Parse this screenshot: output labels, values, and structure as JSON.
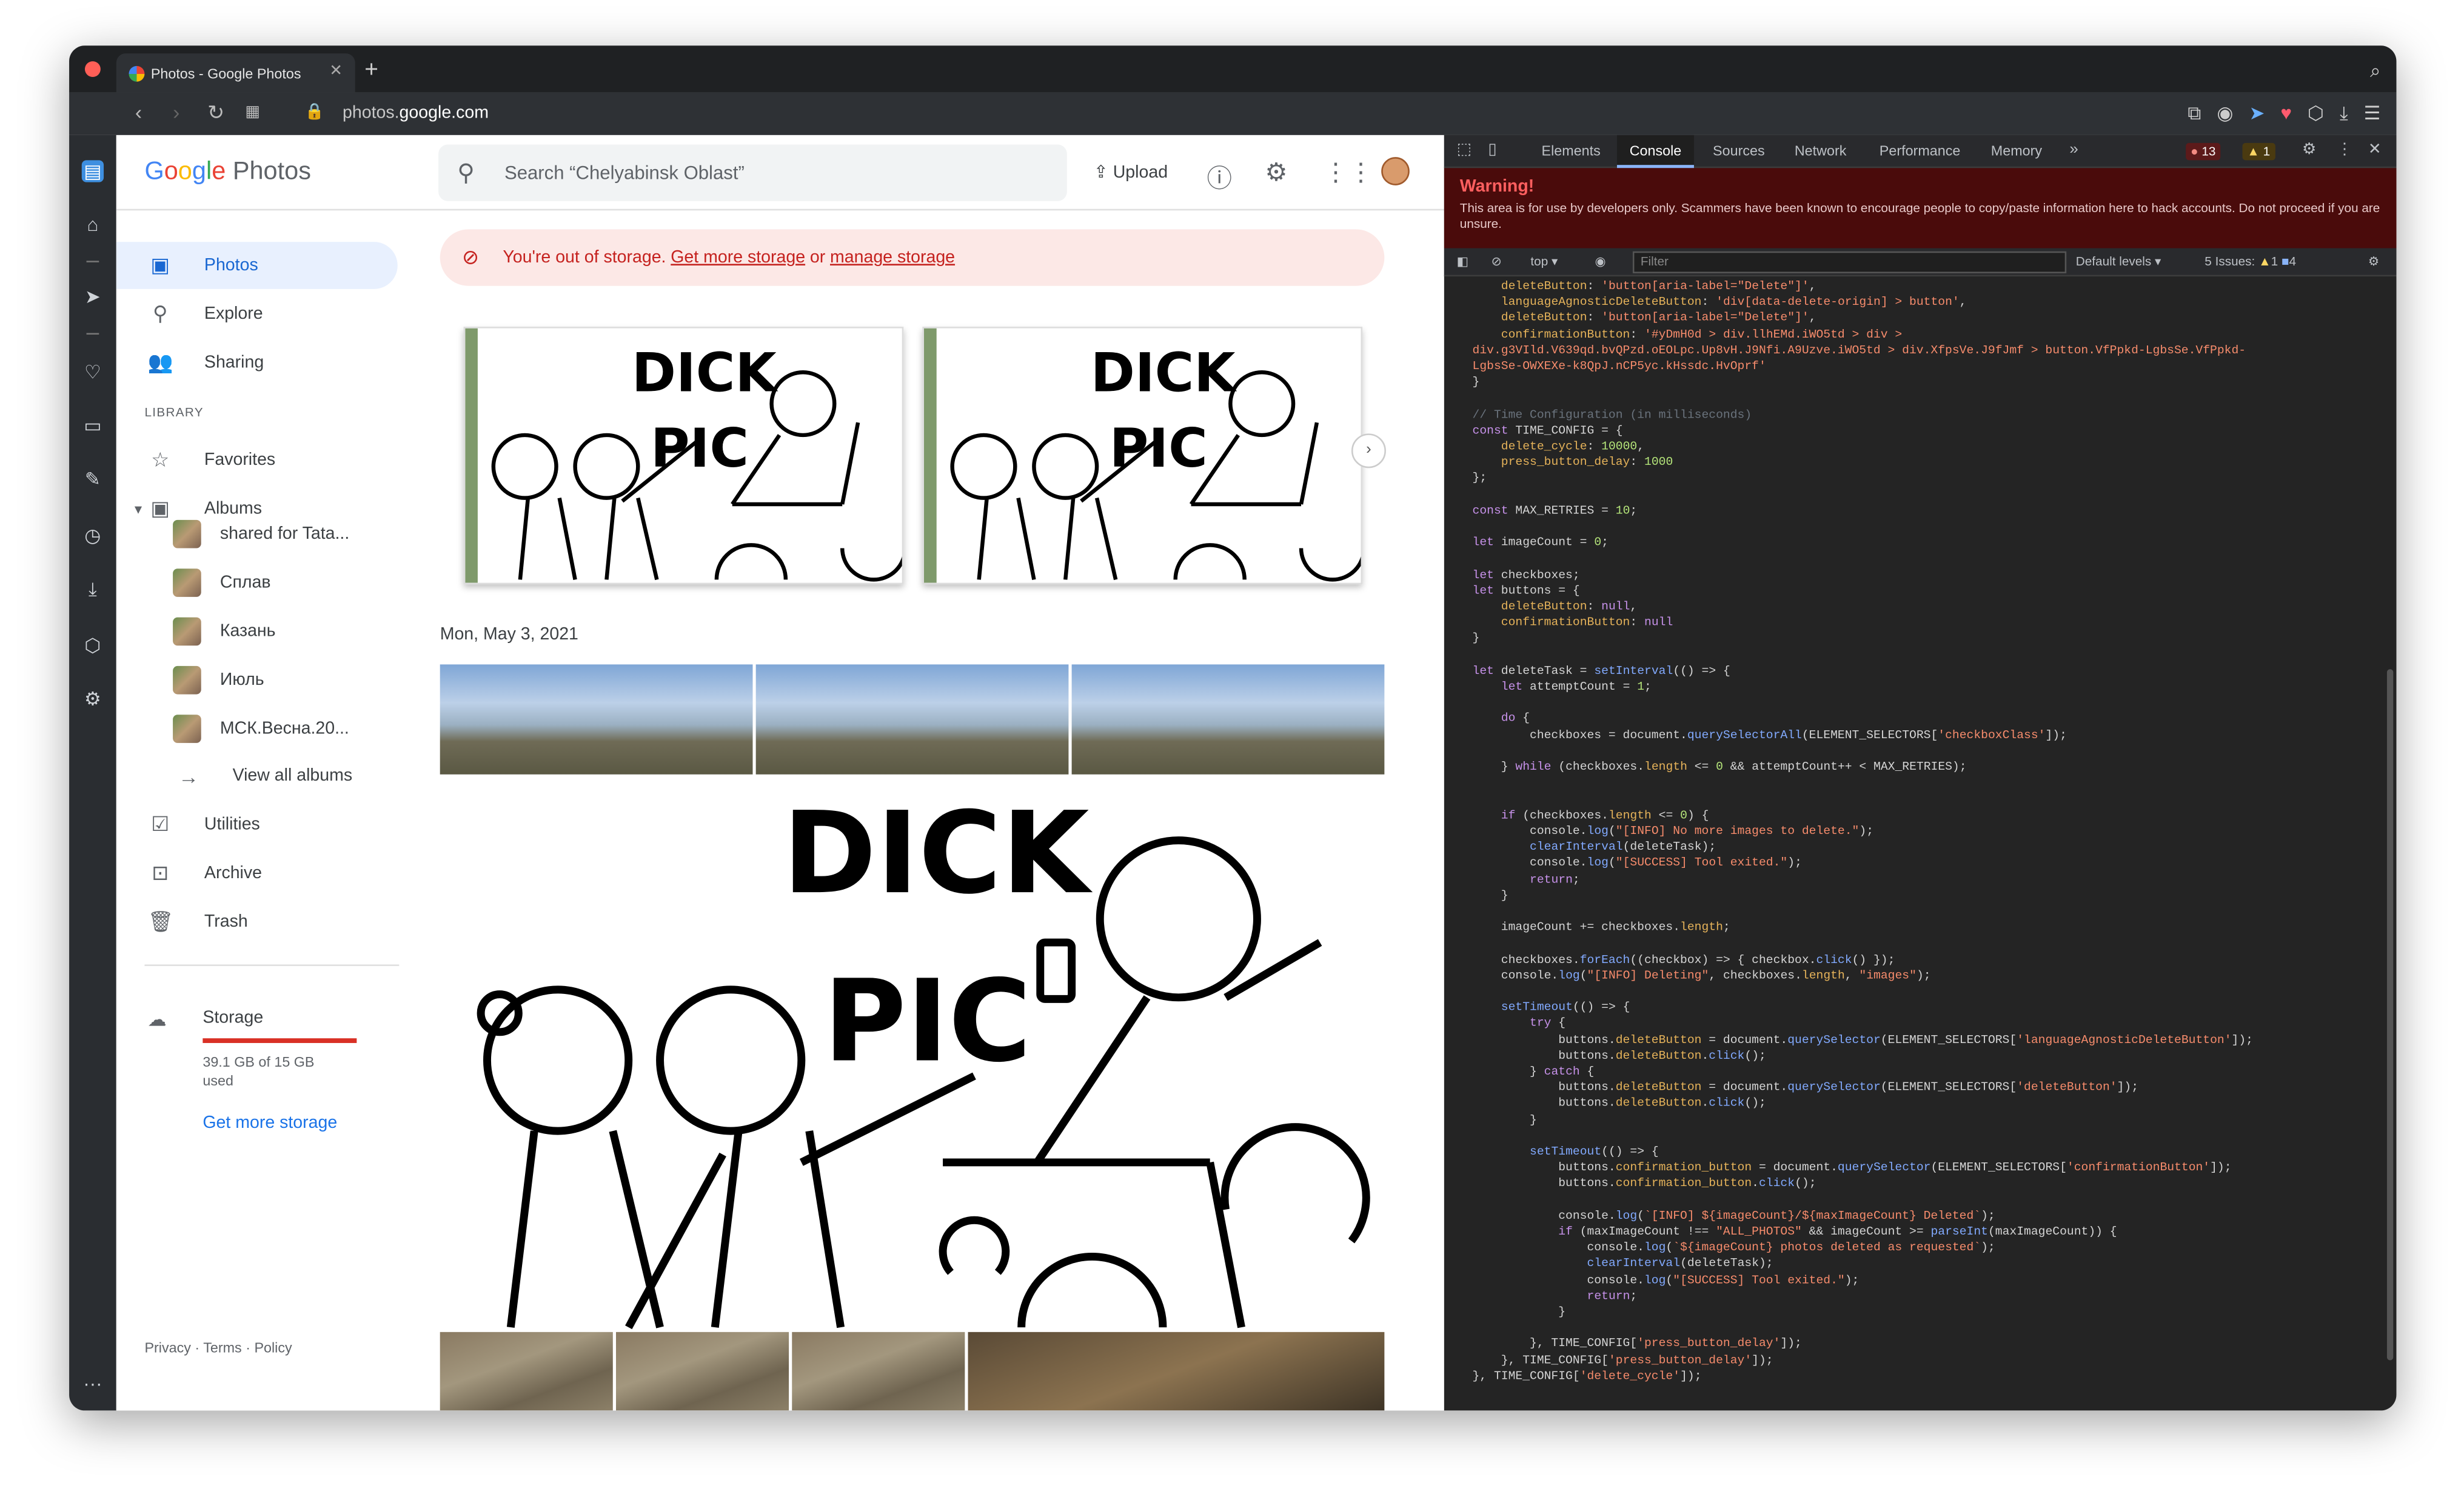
{
  "browser": {
    "tab_title": "Photos - Google Photos",
    "url_prefix": "photos.",
    "url_domain": "google.com"
  },
  "photos": {
    "logo_google": [
      "G",
      "o",
      "o",
      "g",
      "l",
      "e"
    ],
    "logo_product": "Photos",
    "search_placeholder": "Search “Chelyabinsk Oblast”",
    "upload_label": "Upload",
    "nav": {
      "photos": "Photos",
      "explore": "Explore",
      "sharing": "Sharing",
      "library_heading": "LIBRARY",
      "favorites": "Favorites",
      "albums": "Albums",
      "view_all": "View all albums",
      "utilities": "Utilities",
      "archive": "Archive",
      "trash": "Trash"
    },
    "albums": [
      {
        "name": "shared for Tata..."
      },
      {
        "name": "Сплав"
      },
      {
        "name": "Казань"
      },
      {
        "name": "Июль"
      },
      {
        "name": "МСК.Весна.20..."
      }
    ],
    "storage": {
      "label": "Storage",
      "used": "39.1 GB of 15 GB used",
      "more": "Get more storage"
    },
    "footer": "Privacy · Terms · Policy",
    "banner": {
      "text": "You're out of storage.",
      "link1": "Get more storage",
      "mid": "or",
      "link2": "manage storage"
    },
    "meme_line1": "DICK",
    "meme_line2": "PIC",
    "date": "Mon, May 3, 2021"
  },
  "devtools": {
    "tabs": [
      "Elements",
      "Console",
      "Sources",
      "Network",
      "Performance",
      "Memory"
    ],
    "active_tab": "Console",
    "errors": "13",
    "warnings": "1",
    "warning_title": "Warning!",
    "warning_text": "This area is for use by developers only. Scammers have been known to encourage people to copy/paste information here to hack accounts. Do not proceed if you are unsure.",
    "context": "top",
    "filter_placeholder": "Filter",
    "levels": "Default levels",
    "issues": "5 Issues:",
    "issues_warn": "1",
    "issues_info": "4"
  },
  "colors": {
    "accent": "#1967d2",
    "error": "#d93025",
    "devtools_bg": "#242424"
  }
}
